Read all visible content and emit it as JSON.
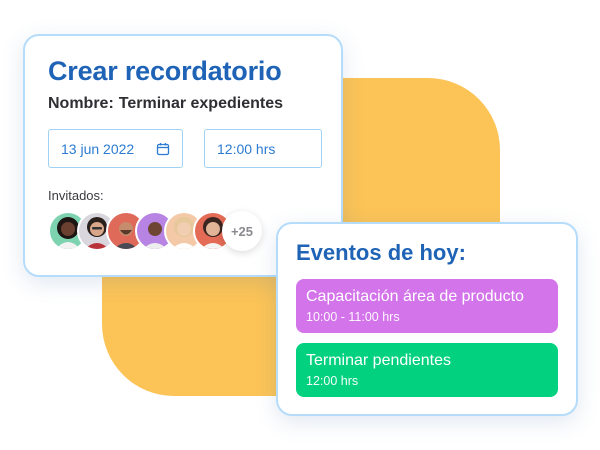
{
  "colors": {
    "accent_blue": "#1F63B6",
    "card_border": "#B5DCFA",
    "backdrop_yellow": "#FCC457",
    "event_purple": "#D474EA",
    "event_green": "#02D17F"
  },
  "reminder": {
    "title": "Crear recordatorio",
    "name_label": "Nombre:",
    "name_value": "Terminar expedientes",
    "date_value": "13 jun 2022",
    "date_icon": "calendar-icon",
    "time_value": "12:00 hrs",
    "guests_label": "Invitados:",
    "guests": [
      {
        "icon": "avatar-woman-curly-hair"
      },
      {
        "icon": "avatar-woman-glasses"
      },
      {
        "icon": "avatar-man-beard"
      },
      {
        "icon": "avatar-man-smiling"
      },
      {
        "icon": "avatar-woman-blonde"
      },
      {
        "icon": "avatar-woman-dark-hair"
      }
    ],
    "more_guests": "+25"
  },
  "events": {
    "title": "Eventos de hoy:",
    "items": [
      {
        "name": "Capacitación área de producto",
        "time": "10:00 - 11:00 hrs",
        "color": "#D474EA"
      },
      {
        "name": "Terminar pendientes",
        "time": "12:00 hrs",
        "color": "#02D17F"
      }
    ]
  }
}
